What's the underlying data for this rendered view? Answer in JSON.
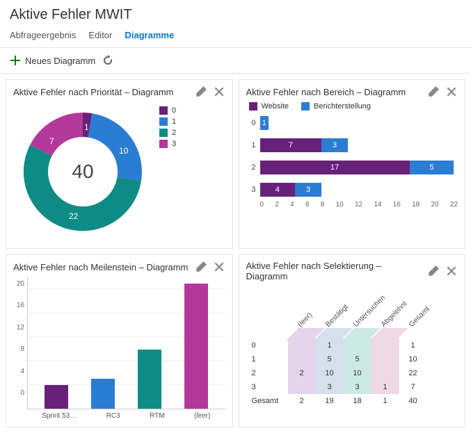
{
  "title": "Aktive Fehler MWIT",
  "tabs": {
    "a": "Abfrageergebnis",
    "b": "Editor",
    "c": "Diagramme"
  },
  "toolbar": {
    "new_chart": "Neues Diagramm"
  },
  "panel1": {
    "title": "Aktive Fehler nach Priorität – Diagramm",
    "center": "40",
    "legend": {
      "l0": "0",
      "l1": "1",
      "l2": "2",
      "l3": "3"
    },
    "labels": {
      "v0": "1",
      "v1": "10",
      "v2": "22",
      "v3": "7"
    }
  },
  "panel2": {
    "title": "Aktive Fehler nach Bereich – Diagramm",
    "legend": {
      "a": "Website",
      "b": "Berichterstellung"
    },
    "rows": {
      "r0": "0",
      "r1": "1",
      "r2": "2",
      "r3": "3"
    },
    "v": {
      "r0a": "1",
      "r1a": "7",
      "r1b": "3",
      "r2a": "17",
      "r2b": "5",
      "r3a": "4",
      "r3b": "3"
    },
    "xticks": {
      "t0": "0",
      "t2": "2",
      "t4": "4",
      "t6": "6",
      "t8": "8",
      "t10": "10",
      "t12": "12",
      "t14": "14",
      "t16": "16",
      "t18": "18",
      "t20": "20",
      "t22": "22"
    }
  },
  "panel3": {
    "title": "Aktive Fehler nach Meilenstein – Diagramm",
    "yticks": {
      "y20": "20",
      "y16": "16",
      "y12": "12",
      "y8": "8",
      "y4": "4",
      "y0": "0"
    },
    "xlabels": {
      "c0": "Sprint 53…",
      "c1": "RC3",
      "c2": "RTM",
      "c3": "(leer)"
    }
  },
  "panel4": {
    "title": "Aktive Fehler nach Selektierung – Diagramm",
    "headers": {
      "h0": "(leer)",
      "h1": "Bestätigt",
      "h2": "Untersuchen",
      "h3": "Abgelehnt",
      "h4": "Gesamt"
    },
    "rows": {
      "r0": {
        "lbl": "0",
        "c1": "1",
        "tot": "1"
      },
      "r1": {
        "lbl": "1",
        "c1": "5",
        "c2": "5",
        "tot": "10"
      },
      "r2": {
        "lbl": "2",
        "c0": "2",
        "c1": "10",
        "c2": "10",
        "tot": "22"
      },
      "r3": {
        "lbl": "3",
        "c1": "3",
        "c2": "3",
        "c3": "1",
        "tot": "7"
      },
      "rt": {
        "lbl": "Gesamt",
        "c0": "2",
        "c1": "19",
        "c2": "18",
        "c3": "1",
        "tot": "40"
      }
    }
  },
  "chart_data": [
    {
      "type": "pie",
      "title": "Aktive Fehler nach Priorität – Diagramm",
      "categories": [
        "0",
        "1",
        "2",
        "3"
      ],
      "values": [
        1,
        10,
        22,
        7
      ],
      "total": 40,
      "colors": [
        "#68217a",
        "#2b7cd3",
        "#0f8b85",
        "#b4389a"
      ]
    },
    {
      "type": "bar",
      "orientation": "horizontal",
      "stacked": true,
      "title": "Aktive Fehler nach Bereich – Diagramm",
      "categories": [
        "0",
        "1",
        "2",
        "3"
      ],
      "series": [
        {
          "name": "Website",
          "values": [
            0,
            7,
            17,
            4
          ],
          "color": "#68217a"
        },
        {
          "name": "Berichterstellung",
          "values": [
            1,
            3,
            5,
            3
          ],
          "color": "#2b7cd3"
        }
      ],
      "xlabel": "",
      "ylabel": "",
      "xlim": [
        0,
        22
      ]
    },
    {
      "type": "bar",
      "title": "Aktive Fehler nach Meilenstein – Diagramm",
      "categories": [
        "Sprint 53…",
        "RC3",
        "RTM",
        "(leer)"
      ],
      "values": [
        4,
        5,
        10,
        21
      ],
      "colors": [
        "#68217a",
        "#2b7cd3",
        "#0f8b85",
        "#b4389a"
      ],
      "ylim": [
        0,
        22
      ]
    },
    {
      "type": "table",
      "title": "Aktive Fehler nach Selektierung – Diagramm",
      "columns": [
        "(leer)",
        "Bestätigt",
        "Untersuchen",
        "Abgelehnt",
        "Gesamt"
      ],
      "rows": [
        "0",
        "1",
        "2",
        "3",
        "Gesamt"
      ],
      "data": [
        [
          null,
          1,
          null,
          null,
          1
        ],
        [
          null,
          5,
          5,
          null,
          10
        ],
        [
          2,
          10,
          10,
          null,
          22
        ],
        [
          null,
          3,
          3,
          1,
          7
        ],
        [
          2,
          19,
          18,
          1,
          40
        ]
      ]
    }
  ]
}
